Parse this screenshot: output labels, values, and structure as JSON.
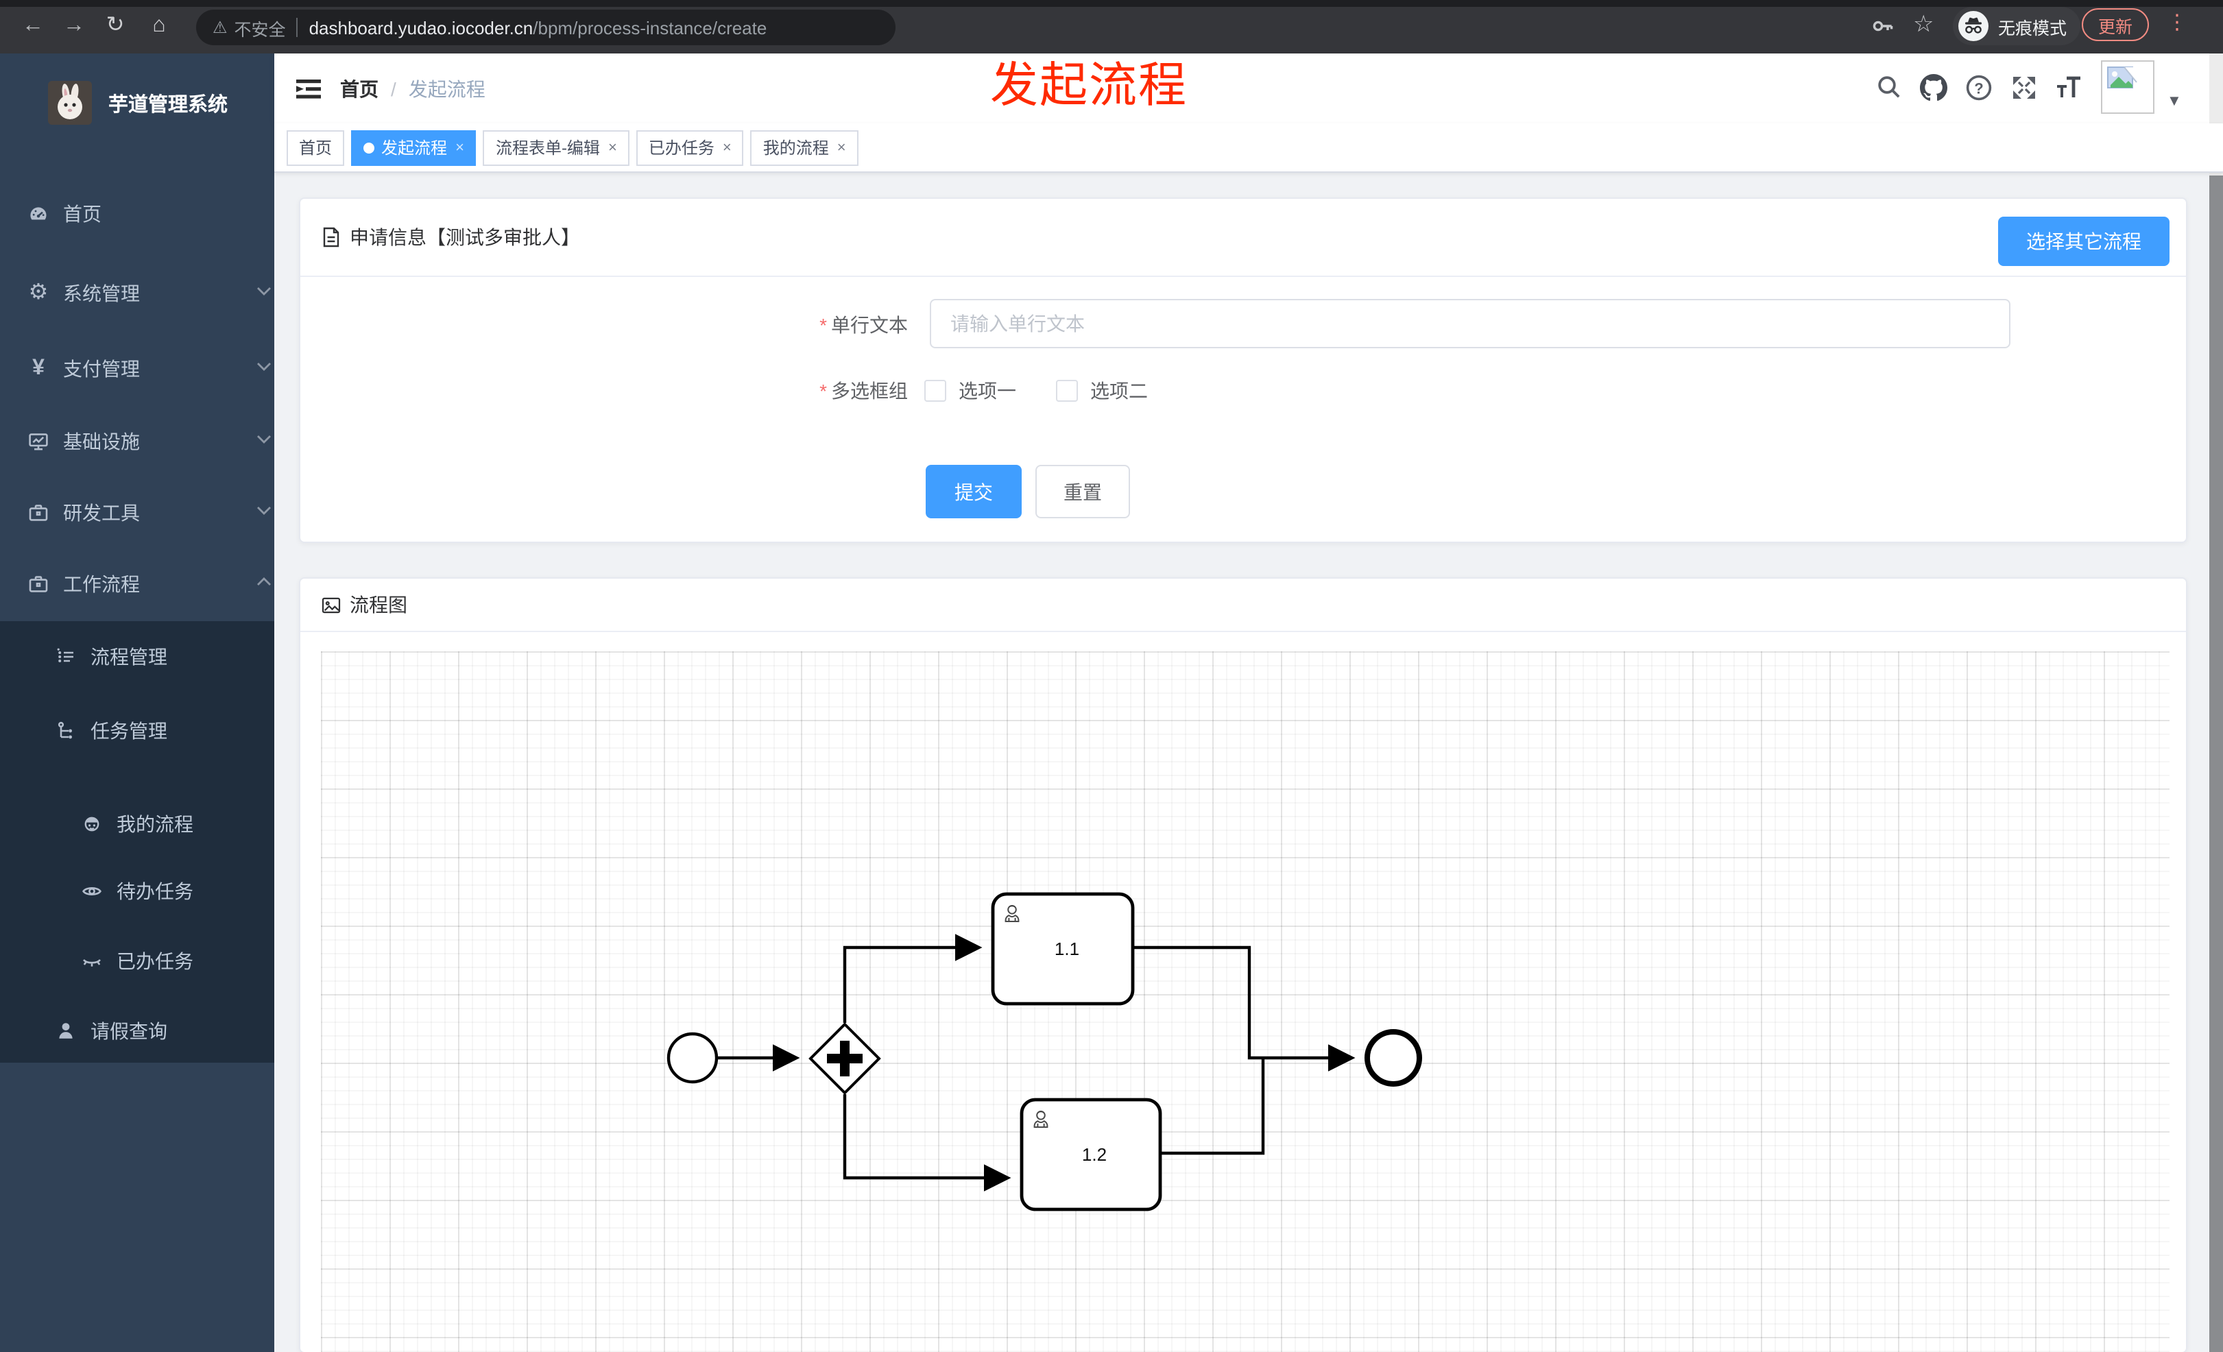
{
  "browser": {
    "security_label": "不安全",
    "url_host": "dashboard.yudao.iocoder.cn",
    "url_path": "/bpm/process-instance/create",
    "incognito_label": "无痕模式",
    "update_label": "更新"
  },
  "glyphs": {
    "back": "←",
    "forward": "→",
    "reload": "↻",
    "home": "⌂",
    "warning": "⚠",
    "star": "☆",
    "dots": "⋮",
    "caret_down": "▼",
    "breadcrumb_sep": "/",
    "close": "×",
    "required": "*",
    "yen": "¥",
    "gear": "⚙"
  },
  "annotation": {
    "text": "发起流程",
    "color": "#ff2a00"
  },
  "sidebar": {
    "title": "芋道管理系统",
    "items": [
      {
        "label": "首页",
        "icon": "dashboard-icon"
      },
      {
        "label": "系统管理",
        "icon": "gear-icon",
        "chevron": "down"
      },
      {
        "label": "支付管理",
        "icon": "yen-icon",
        "chevron": "down"
      },
      {
        "label": "基础设施",
        "icon": "monitor-icon",
        "chevron": "down"
      },
      {
        "label": "研发工具",
        "icon": "toolbox-icon",
        "chevron": "down"
      },
      {
        "label": "工作流程",
        "icon": "briefcase-icon",
        "chevron": "up"
      },
      {
        "label": "流程管理",
        "icon": "list-icon",
        "chevron": "down"
      },
      {
        "label": "任务管理",
        "icon": "tree-icon",
        "chevron": "up"
      },
      {
        "label": "我的流程",
        "icon": "people-icon"
      },
      {
        "label": "待办任务",
        "icon": "eye-icon"
      },
      {
        "label": "已办任务",
        "icon": "eye-closed-icon"
      },
      {
        "label": "请假查询",
        "icon": "user-icon"
      }
    ]
  },
  "header": {
    "breadcrumb_first": "首页",
    "breadcrumb_last": "发起流程"
  },
  "tabs": [
    {
      "label": "首页",
      "active": false,
      "closable": false
    },
    {
      "label": "发起流程",
      "active": true,
      "closable": true
    },
    {
      "label": "流程表单-编辑",
      "active": false,
      "closable": true
    },
    {
      "label": "已办任务",
      "active": false,
      "closable": true
    },
    {
      "label": "我的流程",
      "active": false,
      "closable": true
    }
  ],
  "form_card": {
    "title": "申请信息【测试多审批人】",
    "other_process_button": "选择其它流程",
    "single_line": {
      "label": "单行文本",
      "placeholder": "请输入单行文本",
      "required": true,
      "value": ""
    },
    "checkbox_group": {
      "label": "多选框组",
      "required": true,
      "options": [
        {
          "label": "选项一",
          "checked": false
        },
        {
          "label": "选项二",
          "checked": false
        }
      ]
    },
    "submit_label": "提交",
    "reset_label": "重置"
  },
  "flow_card": {
    "title": "流程图",
    "diagram": {
      "type": "bpmn",
      "nodes": [
        {
          "id": "start",
          "kind": "start-event"
        },
        {
          "id": "gateway",
          "kind": "parallel-gateway"
        },
        {
          "id": "task1",
          "kind": "user-task",
          "label": "1.1"
        },
        {
          "id": "task2",
          "kind": "user-task",
          "label": "1.2"
        },
        {
          "id": "end",
          "kind": "end-event"
        }
      ],
      "flows": [
        "start→gateway",
        "gateway→task1",
        "gateway→task2",
        "task1→end",
        "task2→end"
      ]
    }
  },
  "colors": {
    "accent": "#409eff",
    "annotation_red": "#ff2a00",
    "sidebar_bg": "#304156",
    "submenu_bg": "#1f2d3d",
    "update_pill": "#f28b82",
    "tab_border": "#d8dce5"
  }
}
